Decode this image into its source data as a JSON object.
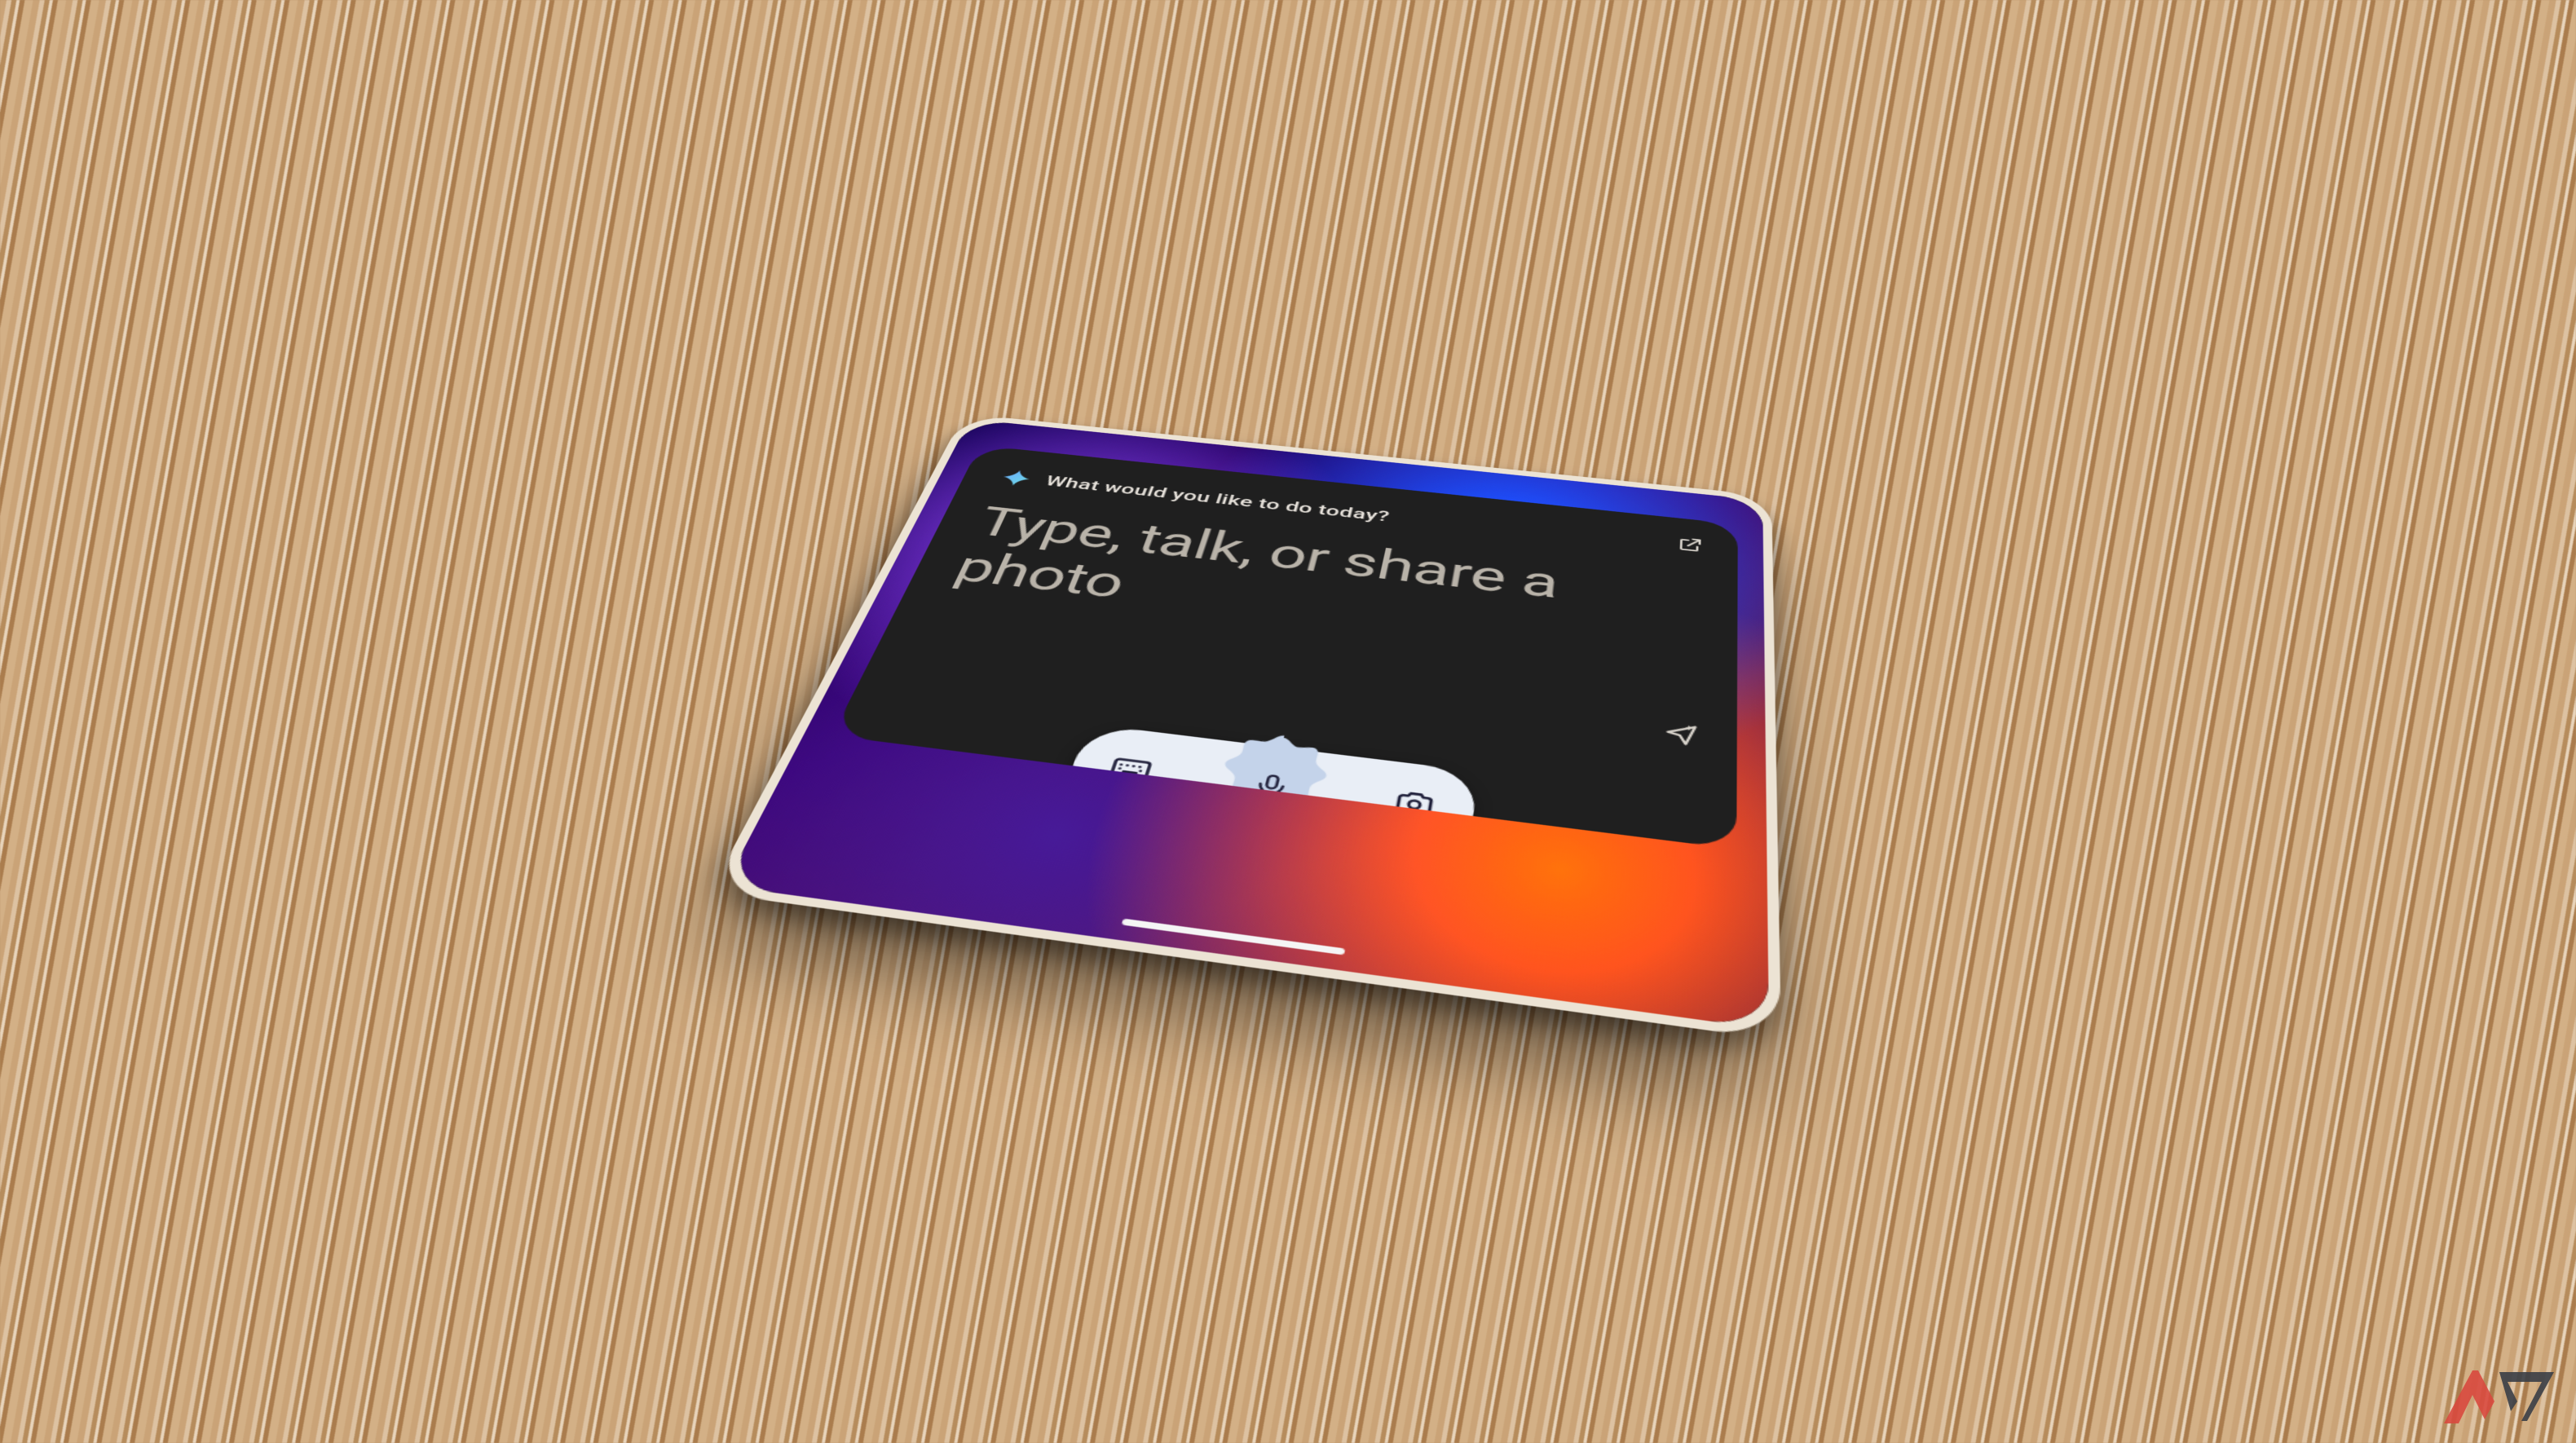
{
  "assistant": {
    "heading": "What would you like to do today?",
    "placeholder": "Type, talk, or share a photo",
    "actions": {
      "expand_label": "Open in full app",
      "send_label": "Send",
      "keyboard_label": "Keyboard input",
      "mic_label": "Voice input",
      "camera_label": "Camera input"
    }
  },
  "icons": {
    "spark": "gemini-spark-icon",
    "expand": "external-link-icon",
    "send": "send-spark-icon",
    "keyboard": "keyboard-icon",
    "mic": "microphone-icon",
    "camera": "camera-icon"
  },
  "colors": {
    "card_bg": "#1f1f1f",
    "text_secondary": "#b9b3a9",
    "pill_bg": "#e9eef6",
    "burst": "#c4d3ea",
    "spark_a": "#6aa7ff",
    "spark_b": "#6ee0e4"
  },
  "watermark": {
    "text": "AP"
  }
}
